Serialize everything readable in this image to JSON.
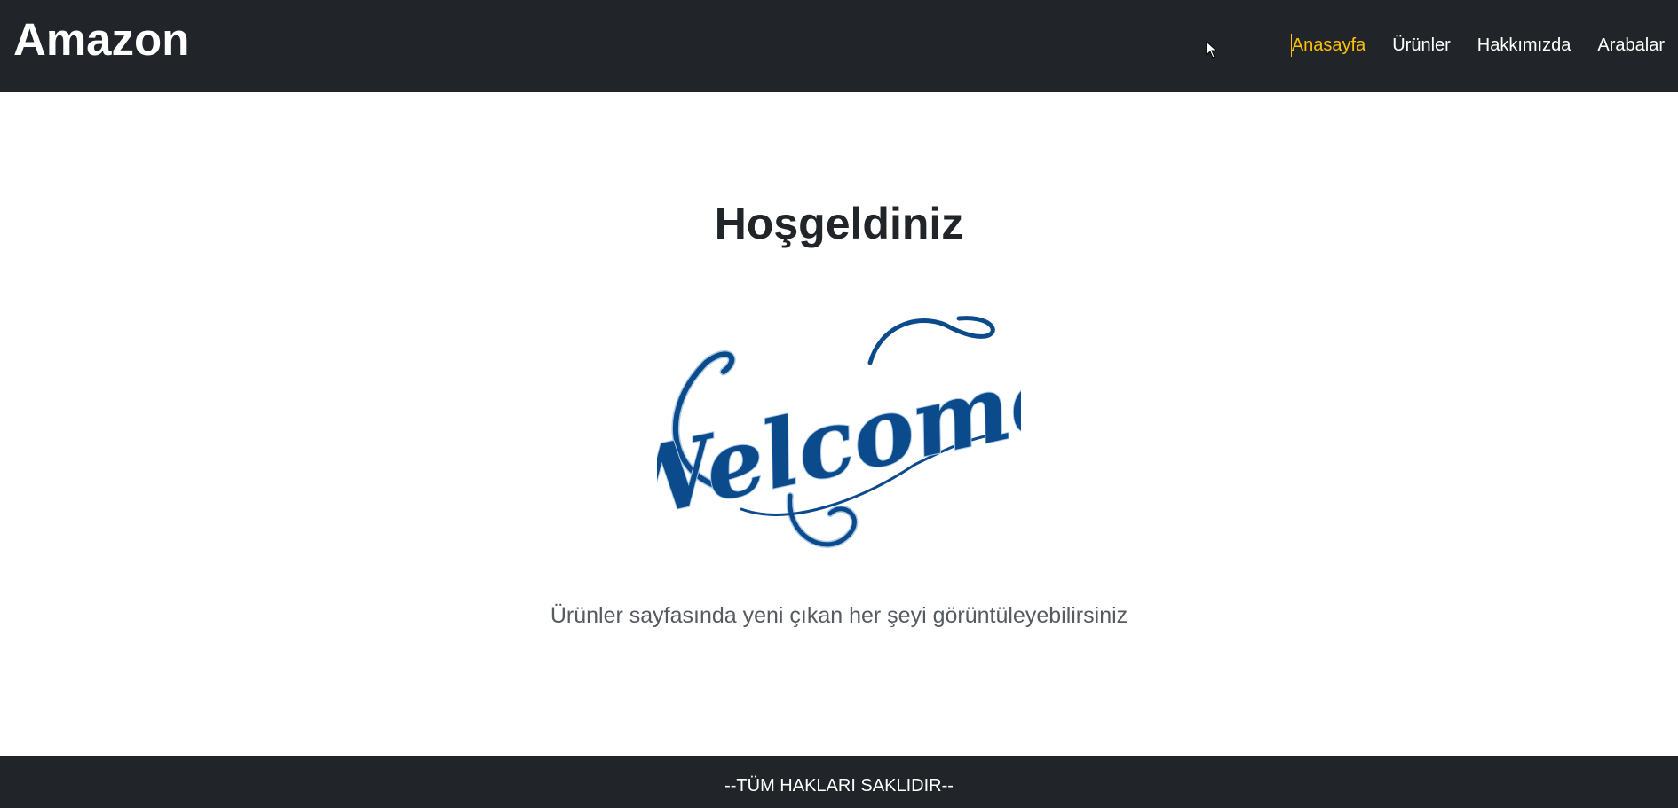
{
  "navbar": {
    "brand": "Amazon",
    "links": [
      {
        "label": "Anasayfa",
        "active": true
      },
      {
        "label": "Ürünler",
        "active": false
      },
      {
        "label": "Hakkımızda",
        "active": false
      },
      {
        "label": "Arabalar",
        "active": false
      }
    ],
    "active_color": "#ffc107",
    "background": "#212529"
  },
  "hero": {
    "title": "Hoşgeldiniz",
    "image": {
      "icon": "welcome-script-image",
      "text": "Welcome",
      "color": "#0b4a8b"
    },
    "subtitle": "Ürünler sayfasında yeni çıkan her şeyi görüntüleyebilirsiniz"
  },
  "footer": {
    "text": "--TÜM HAKLARI SAKLIDIR--"
  },
  "cursor": {
    "icon": "mouse-pointer-icon"
  }
}
